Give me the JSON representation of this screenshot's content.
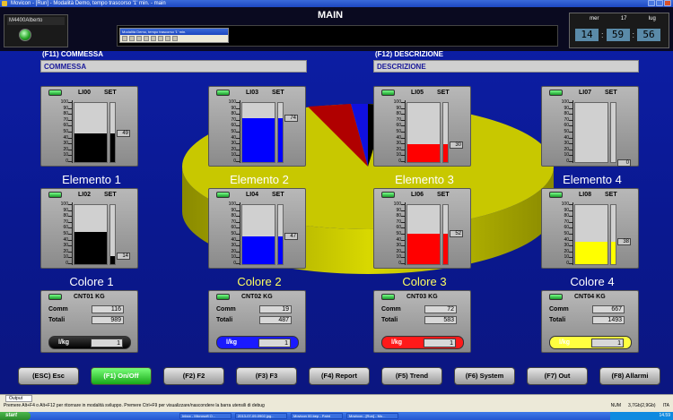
{
  "window": {
    "title": "Movicon - [Run] - Modalità Demo, tempo trascorso '1' min. - main"
  },
  "header": {
    "user": "M4400Alberto",
    "title": "MAIN",
    "mini_window_title": "Modalità Demo, tempo trascorso '1' min.",
    "date": {
      "day": "mer",
      "num": "17",
      "month": "lug"
    },
    "time": {
      "h": "14",
      "m": "59",
      "s": "56"
    }
  },
  "sections": {
    "commessa_label": "(F11) COMMESSA",
    "commessa_value": "COMMESSA",
    "descrizione_label": "(F12) DESCRIZIONE",
    "descrizione_value": "DESCRIZIONE"
  },
  "scale": [
    "100",
    "90",
    "80",
    "70",
    "60",
    "50",
    "40",
    "30",
    "20",
    "10",
    "0"
  ],
  "set_label": "SET",
  "tanks": [
    {
      "tag": "LI00",
      "level": 0.49,
      "set": "49",
      "color": "#000000",
      "label": "Elemento 1"
    },
    {
      "tag": "LI03",
      "level": 0.74,
      "set": "74",
      "color": "#0000ff",
      "label": "Elemento 2"
    },
    {
      "tag": "LI05",
      "level": 0.3,
      "set": "30",
      "color": "#ff0000",
      "label": "Elemento 3"
    },
    {
      "tag": "LI07",
      "level": 0.0,
      "set": "0",
      "color": "#ffff00",
      "label": "Elemento 4"
    },
    {
      "tag": "LI02",
      "level": 0.55,
      "set": "14",
      "color": "#000000",
      "label": "Colore 1"
    },
    {
      "tag": "LI04",
      "level": 0.47,
      "set": "47",
      "color": "#0000ff",
      "label": "Colore 2"
    },
    {
      "tag": "LI06",
      "level": 0.52,
      "set": "52",
      "color": "#ff0000",
      "label": "Colore 3"
    },
    {
      "tag": "LI08",
      "level": 0.38,
      "set": "38",
      "color": "#ffff00",
      "label": "Colore 4"
    }
  ],
  "counters": [
    {
      "tag": "CNT01",
      "unit": "KG",
      "comm_label": "Comm",
      "comm": "116",
      "totali_label": "Totali",
      "totali": "989",
      "rate_label": "l/kg",
      "rate": "1",
      "color": "#000000"
    },
    {
      "tag": "CNT02",
      "unit": "KG",
      "comm_label": "Comm",
      "comm": "19",
      "totali_label": "Totali",
      "totali": "487",
      "rate_label": "l/kg",
      "rate": "1",
      "color": "#1a1aff"
    },
    {
      "tag": "CNT03",
      "unit": "KG",
      "comm_label": "Comm",
      "comm": "72",
      "totali_label": "Totali",
      "totali": "583",
      "rate_label": "l/kg",
      "rate": "1",
      "color": "#ff1a1a"
    },
    {
      "tag": "CNT04",
      "unit": "KG",
      "comm_label": "Comm",
      "comm": "667",
      "totali_label": "Totali",
      "totali": "1493",
      "rate_label": "l/kg",
      "rate": "1",
      "color": "#ffff40"
    }
  ],
  "fkeys": [
    "(ESC) Esc",
    "(F1) On/Off",
    "(F2) F2",
    "(F3) F3",
    "(F4) Report",
    "(F5) Trend",
    "(F6) System",
    "(F7) Out",
    "(F8) Allarmi"
  ],
  "output": {
    "tab": "Output",
    "status": "Premere Alt+F4 o Alt+F12 per ritornare in modalità sviluppo. Premere Ctrl+F9 per visualizzare/nascondere la barra utensili di debug",
    "num": "NUM",
    "mem": "3,7Gb(2,9Gb)",
    "lang": "ITA"
  },
  "taskbar": {
    "start": "start",
    "items": [
      "Inbox - Microsoft O...",
      "2013-07-09-0902.jpg...",
      "Movicon 00.bep - Paint",
      "Movicon - [Run] - Mo..."
    ],
    "clock": "14.59"
  }
}
